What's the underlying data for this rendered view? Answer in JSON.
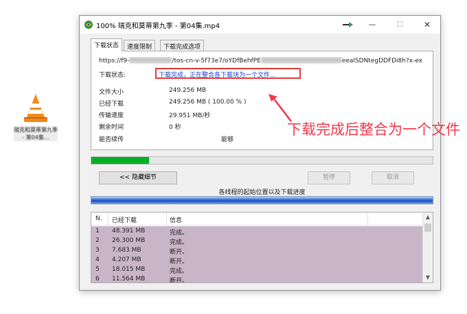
{
  "desktop_icon": {
    "label": "瑞克和莫蒂第九季 - 第04集..."
  },
  "window": {
    "title": "100% 瑞克和莫蒂第九季 - 第04集.mp4",
    "minimize": "—",
    "maximize": "☐",
    "close": "✕"
  },
  "tabs": [
    "下载状态",
    "速度限制",
    "下载完成选项"
  ],
  "details": {
    "url_prefix": "https://f9-",
    "url_middle": "/tos-cn-v-5f73e7/oYDfBehfPE",
    "url_suffix": "eealSDNtegDDFDi8h?x-ex",
    "status_label": "下载状态:",
    "status_value": "下载完成，正在整合各下载块为一个文件...",
    "rows": [
      {
        "label": "文件大小",
        "value": "249.256  MB"
      },
      {
        "label": "已经下载",
        "value": "249.256  MB  ( 100.00 % )"
      },
      {
        "label": "传输速度",
        "value": "29.951  MB/秒"
      },
      {
        "label": "剩余时间",
        "value": "0 秒"
      },
      {
        "label": "能否续传",
        "value": "能够"
      }
    ]
  },
  "annotation": "下载完成后整合为一个文件",
  "progress": {
    "percent": 17
  },
  "buttons": {
    "hide_details": "<< 隐藏细节",
    "pause": "暂停",
    "cancel": "取消"
  },
  "thread_label": "各线程的起始位置以及下载进度",
  "table": {
    "headers": [
      "N.",
      "已经下载",
      "信息"
    ],
    "rows": [
      [
        "1",
        "48.391 MB",
        "完成。"
      ],
      [
        "2",
        "26.300 MB",
        "完成。"
      ],
      [
        "3",
        "7.683 MB",
        "断开。"
      ],
      [
        "4",
        "4.207 MB",
        "断开。"
      ],
      [
        "5",
        "18.015 MB",
        "完成。"
      ],
      [
        "6",
        "11.564 MB",
        "断开。"
      ]
    ]
  },
  "colors": {
    "accent_red": "#ee3a4c",
    "progress_green": "#06b025",
    "row_bg": "#c9b5c8",
    "status_blue": "#1a3fd0"
  }
}
